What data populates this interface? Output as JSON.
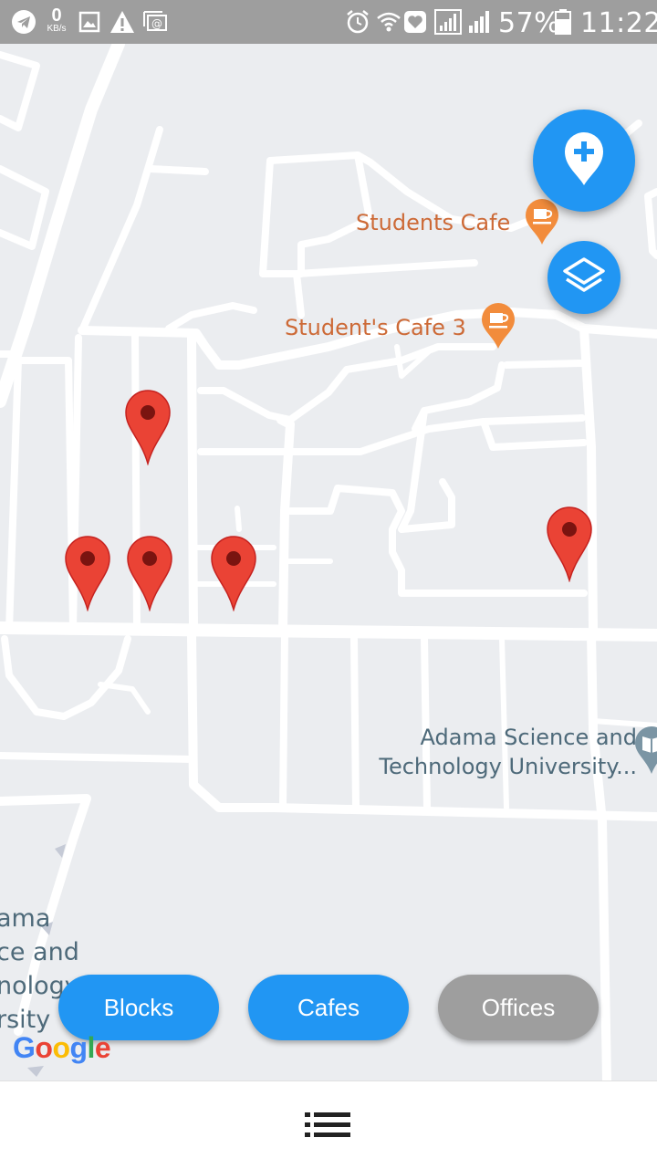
{
  "status_bar": {
    "net_speed_value": "0",
    "net_speed_unit": "KB/s",
    "battery_percent": "57%",
    "time": "11:22",
    "icons": [
      "telegram-icon",
      "image-icon",
      "warning-icon",
      "email-icon",
      "alarm-icon",
      "wifi-icon",
      "heart-icon",
      "signal-icon",
      "signal-icon",
      "battery-icon"
    ]
  },
  "map": {
    "places": [
      {
        "name": "Students Cafe",
        "type": "cafe"
      },
      {
        "name": "Student's Cafe 3",
        "type": "cafe"
      },
      {
        "name": "Adama Science and Technology University...",
        "type": "university"
      }
    ],
    "partial_label": [
      "ama",
      "ce and",
      "nology",
      "rsity"
    ],
    "provider": "Google",
    "marker_color": "#ea4335",
    "marker_count": 5
  },
  "fabs": {
    "add_marker_icon": "add-location-icon",
    "layers_icon": "layers-icon"
  },
  "filters": [
    {
      "label": "Blocks",
      "active": true
    },
    {
      "label": "Cafes",
      "active": true
    },
    {
      "label": "Offices",
      "active": false
    }
  ],
  "colors": {
    "accent": "#2196f3",
    "inactive": "#9e9e9e",
    "cafe_label": "#cd6a37",
    "university_label": "#4e6a7a"
  },
  "bottom_bar": {
    "menu_icon": "menu-list-icon"
  }
}
